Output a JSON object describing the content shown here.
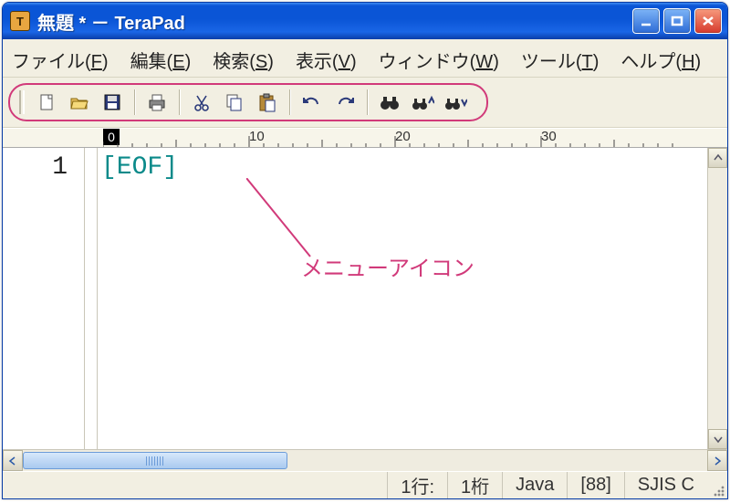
{
  "window": {
    "title": "無題 * － TeraPad"
  },
  "menu": {
    "file": {
      "label": "ファイル(",
      "mnemonic": "F",
      "suffix": ")"
    },
    "edit": {
      "label": "編集(",
      "mnemonic": "E",
      "suffix": ")"
    },
    "search": {
      "label": "検索(",
      "mnemonic": "S",
      "suffix": ")"
    },
    "view": {
      "label": "表示(",
      "mnemonic": "V",
      "suffix": ")"
    },
    "window": {
      "label": "ウィンドウ(",
      "mnemonic": "W",
      "suffix": ")"
    },
    "tool": {
      "label": "ツール(",
      "mnemonic": "T",
      "suffix": ")"
    },
    "help": {
      "label": "ヘルプ(",
      "mnemonic": "H",
      "suffix": ")"
    }
  },
  "ruler": {
    "caret": "0",
    "marks": [
      "10",
      "20",
      "30"
    ]
  },
  "editor": {
    "line_number": "1",
    "eof": "[EOF]"
  },
  "status": {
    "line": "1行:",
    "col": "1桁",
    "mode": "Java",
    "code": "[88]",
    "enc": "SJIS  C"
  },
  "annotation": {
    "label": "メニューアイコン"
  },
  "colors": {
    "titlebar_top": "#3f8cf3",
    "titlebar_bottom": "#0a3ea8",
    "menu_bg": "#f2efe2",
    "highlight": "#d13a7a",
    "eof": "#0b8a8a"
  }
}
